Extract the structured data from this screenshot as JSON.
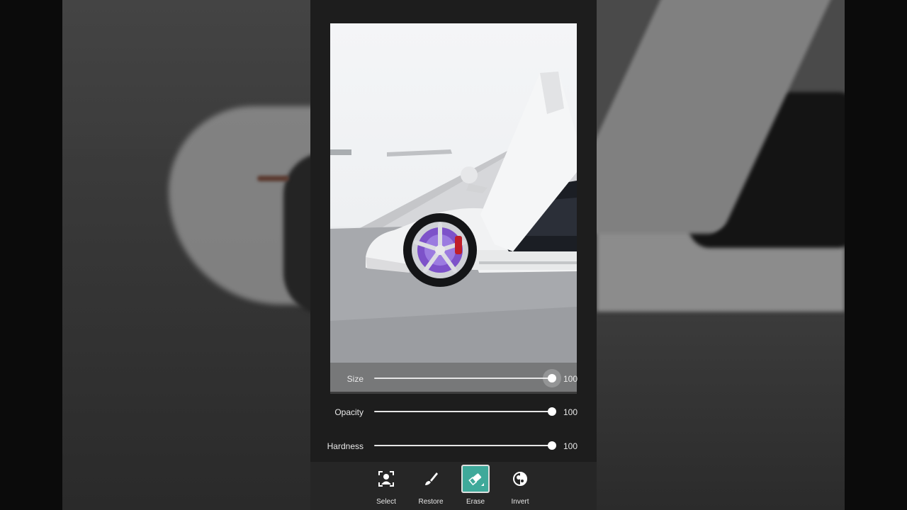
{
  "sliders": [
    {
      "label": "Size",
      "value": "100",
      "level": 1.0
    },
    {
      "label": "Opacity",
      "value": "100",
      "level": 1.0
    },
    {
      "label": "Hardness",
      "value": "100",
      "level": 1.0
    }
  ],
  "tools": [
    {
      "label": "Select",
      "icon": "select-person-icon",
      "active": false
    },
    {
      "label": "Restore",
      "icon": "brush-icon",
      "active": false
    },
    {
      "label": "Erase",
      "icon": "eraser-icon",
      "active": true
    },
    {
      "label": "Invert",
      "icon": "invert-icon",
      "active": false
    }
  ],
  "colors": {
    "accent": "#3fa99a",
    "panel": "#1d1d1d",
    "toolbar": "#262626"
  }
}
